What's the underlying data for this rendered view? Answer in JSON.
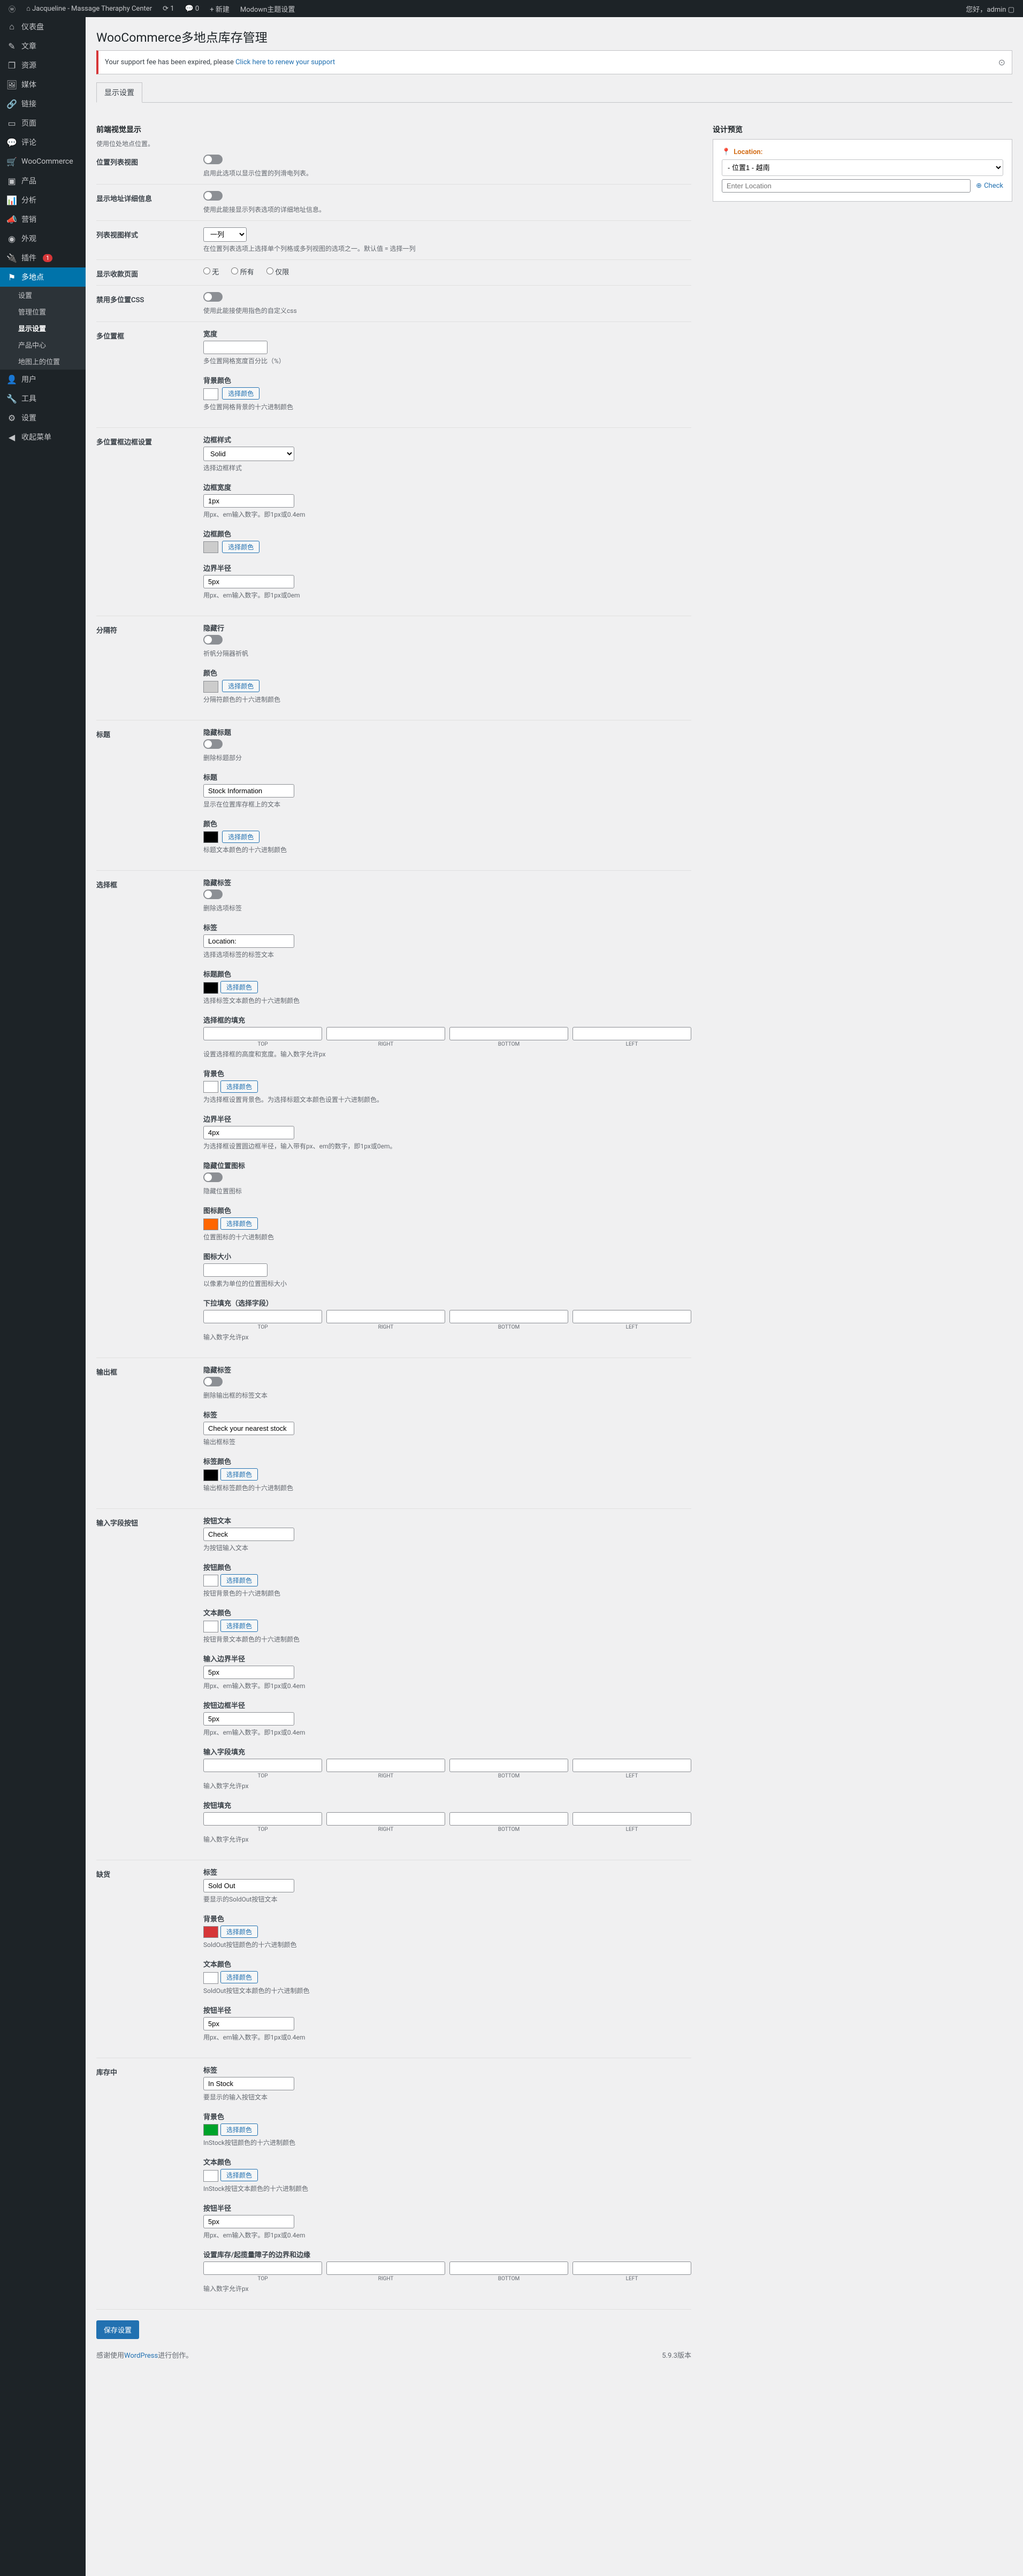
{
  "adminbar": {
    "site": "Jacqueline - Massage Theraphy Center",
    "updates": "1",
    "comments": "0",
    "new": "新建",
    "modown": "Modown主题设置",
    "greeting": "您好，",
    "user": "admin"
  },
  "sidebar": {
    "items": [
      {
        "icon": "⌂",
        "label": "仪表盘"
      },
      {
        "icon": "✎",
        "label": "文章"
      },
      {
        "icon": "❐",
        "label": "资源"
      },
      {
        "icon": "🖼",
        "label": "媒体"
      },
      {
        "icon": "🔗",
        "label": "链接"
      },
      {
        "icon": "▭",
        "label": "页面"
      },
      {
        "icon": "💬",
        "label": "评论"
      },
      {
        "icon": "🛒",
        "label": "WooCommerce"
      },
      {
        "icon": "▣",
        "label": "产品"
      },
      {
        "icon": "📊",
        "label": "分析"
      },
      {
        "icon": "📣",
        "label": "营销"
      },
      {
        "icon": "◉",
        "label": "外观"
      },
      {
        "icon": "🔌",
        "label": "插件",
        "badge": "1"
      },
      {
        "icon": "⚑",
        "label": "多地点",
        "current": true
      },
      {
        "icon": "👤",
        "label": "用户"
      },
      {
        "icon": "🔧",
        "label": "工具"
      },
      {
        "icon": "⚙",
        "label": "设置"
      },
      {
        "icon": "◀",
        "label": "收起菜单"
      }
    ],
    "submenu": [
      "设置",
      "管理位置",
      "显示设置",
      "产品中心",
      "地图上的位置"
    ],
    "submenu_current": 2
  },
  "page": {
    "title": "WooCommerce多地点库存管理",
    "notice": "Your support fee has been expired, please ",
    "notice_link": "Click here to renew your support",
    "tab": "显示设置"
  },
  "preview": {
    "heading": "设计预览",
    "label": "Location:",
    "select": "- 位置1 - 越南",
    "placeholder": "Enter Location",
    "check": "Check"
  },
  "sections": {
    "frontend": {
      "title": "前端视觉显示",
      "help": "使用位处地点位置。"
    },
    "row1": {
      "label": "位置列表视图",
      "help": "启用此选项以显示位置的列滑电列表。"
    },
    "row2": {
      "label": "显示地址详细信息",
      "help": "使用此能接显示列表选项的详细地址信息。"
    },
    "row3": {
      "label": "列表视图样式",
      "select": "一列",
      "help": "在位置列表选项上选择单个列格或多列视图的选项之一。默认值 = 选择一列"
    },
    "row4": {
      "label": "显示收款页面",
      "options": [
        "无",
        "所有",
        "仅限"
      ],
      "help": "使用此能接使用指色的自定义css"
    },
    "row5": {
      "label": "禁用多位置CSS"
    },
    "multiloc": {
      "label": "多位置框",
      "width_label": "宽度",
      "width_help": "多位置网格宽度百分比（%）",
      "bgcolor_label": "背景颜色",
      "bgcolor_btn": "选择颜色",
      "bgcolor_help": "多位置网格背景的十六进制颜色"
    },
    "border": {
      "label": "多位置框边框设置",
      "style_label": "边框样式",
      "style_value": "Solid",
      "style_help": "选择边框样式",
      "width_label": "边框宽度",
      "width_value": "1px",
      "width_help": "用px、em输入数字。即1px或0.4em",
      "color_label": "边框颜色",
      "color_btn": "选择颜色",
      "radius_label": "边界半径",
      "radius_value": "5px",
      "radius_help": "用px、em输入数字。即1px或0em"
    },
    "divider": {
      "label": "分隔符",
      "hide_label": "隐藏行",
      "hide_help": "祈帆分隔器祈帆",
      "color_label": "颜色",
      "color_btn": "选择颜色",
      "color_help": "分隔符颜色的十六进制颜色"
    },
    "title_sec": {
      "label": "标题",
      "hide_label": "隐藏标题",
      "hide_help": "删除标题部分",
      "title_label": "标题",
      "title_value": "Stock Information",
      "title_help": "显示在位置库存框上的文本",
      "color_label": "颜色",
      "color_btn": "选择颜色",
      "color_swatch": "#000000",
      "color_help": "标题文本颜色的十六进制颜色"
    },
    "select_box": {
      "label": "选择框",
      "hide_label": "隐藏标签",
      "hide_help": "删除选项标签",
      "title_label": "标签",
      "title_value": "Location:",
      "title_help": "选择选项标签的标签文本",
      "titlecolor_label": "标题颜色",
      "titlecolor_btn": "选择颜色",
      "titlecolor_swatch": "#000000",
      "titlecolor_help": "选择标签文本颜色的十六进制颜色",
      "selheight_label": "选择框的填充",
      "selheight_help": "设置选择框的高度和宽度。输入数字允许px",
      "bgcolor_label": "背景色",
      "bgcolor_btn": "选择颜色",
      "bgcolor_help": "为选择框设置背景色。为选择标题文本颜色设置十六进制颜色。",
      "radius_label": "边界半径",
      "radius_value": "4px",
      "radius_help": "为选择框设置圆边框半径，输入带有px、em的数字，即1px或0em。",
      "hideicon_label": "隐藏位置图标",
      "hideicon_help": "隐藏位置图标",
      "iconcolor_label": "图标颜色",
      "iconcolor_btn": "选择颜色",
      "iconcolor_swatch": "#ff6600",
      "iconcolor_help": "位置图标的十六进制颜色",
      "iconsize_label": "图标大小",
      "iconsize_help": "以像素为单位的位置图标大小",
      "dropdown_label": "下拉填充（选择字段）",
      "dropdown_help": "输入数字允许px",
      "spacing_caps": [
        "TOP",
        "RIGHT",
        "BOTTOM",
        "LEFT"
      ]
    },
    "input_box": {
      "label": "输出框",
      "hide_label": "隐藏标签",
      "hide_help": "删除输出框的标签文本",
      "title_label": "标签",
      "title_value": "Check your nearest stock",
      "title_help": "输出框标签",
      "color_label": "标签颜色",
      "color_btn": "选择颜色",
      "color_swatch": "#000000",
      "color_help": "输出框标签颜色的十六进制颜色"
    },
    "input_btn": {
      "label": "输入字段按钮",
      "btntxt_label": "按钮文本",
      "btntxt_value": "Check",
      "btntxt_help": "为按钮输入文本",
      "btncolor_label": "按钮颜色",
      "btncolor_btn": "选择颜色",
      "btncolor_help": "按钮背景色的十六进制颜色",
      "txtcolor_label": "文本颜色",
      "txtcolor_btn": "选择颜色",
      "txtcolor_help": "按钮背景文本颜色的十六进制颜色",
      "inradius_label": "输入边界半径",
      "inradius_value": "5px",
      "inradius_help": "用px、em输入数字。即1px或0.4em",
      "btnradius_label": "按钮边框半径",
      "btnradius_value": "5px",
      "btnradius_help": "用px、em输入数字。即1px或0.4em",
      "inputpad_label": "输入字段填充",
      "inputpad_help": "输入数字允许px",
      "btnpad_label": "按钮填充",
      "btnpad_help": "输入数字允许px"
    },
    "soldout": {
      "label": "缺货",
      "title_label": "标签",
      "title_value": "Sold Out",
      "title_help": "要显示的SoldOut按钮文本",
      "bgcolor_label": "背景色",
      "bgcolor_btn": "选择颜色",
      "bgcolor_swatch": "#d63638",
      "bgcolor_help": "SoldOut按钮颜色的十六进制颜色",
      "txtcolor_label": "文本颜色",
      "txtcolor_btn": "选择颜色",
      "txtcolor_help": "SoldOut按钮文本颜色的十六进制颜色",
      "radius_label": "按钮半径",
      "radius_value": "5px",
      "radius_help": "用px、em输入数字。即1px或0.4em"
    },
    "instock": {
      "label": "库存中",
      "title_label": "标签",
      "title_value": "In Stock",
      "title_help": "要显示的输入按钮文本",
      "bgcolor_label": "背景色",
      "bgcolor_btn": "选择颜色",
      "bgcolor_swatch": "#00a32a",
      "bgcolor_help": "InStock按钮颜色的十六进制颜色",
      "txtcolor_label": "文本颜色",
      "txtcolor_btn": "选择颜色",
      "txtcolor_help": "InStock按钮文本颜色的十六进制颜色",
      "radius_label": "按钮半径",
      "radius_value": "5px",
      "radius_help": "用px、em输入数字。即1px或0.4em",
      "margin_label": "设置库存/起揽量障子的边界和边缘",
      "margin_help": "输入数字允许px"
    }
  },
  "save_btn": "保存设置",
  "footer": {
    "thanks": "感谢使用",
    "wp": "WordPress",
    "creation": "进行创作。",
    "version": "5.9.3版本"
  }
}
